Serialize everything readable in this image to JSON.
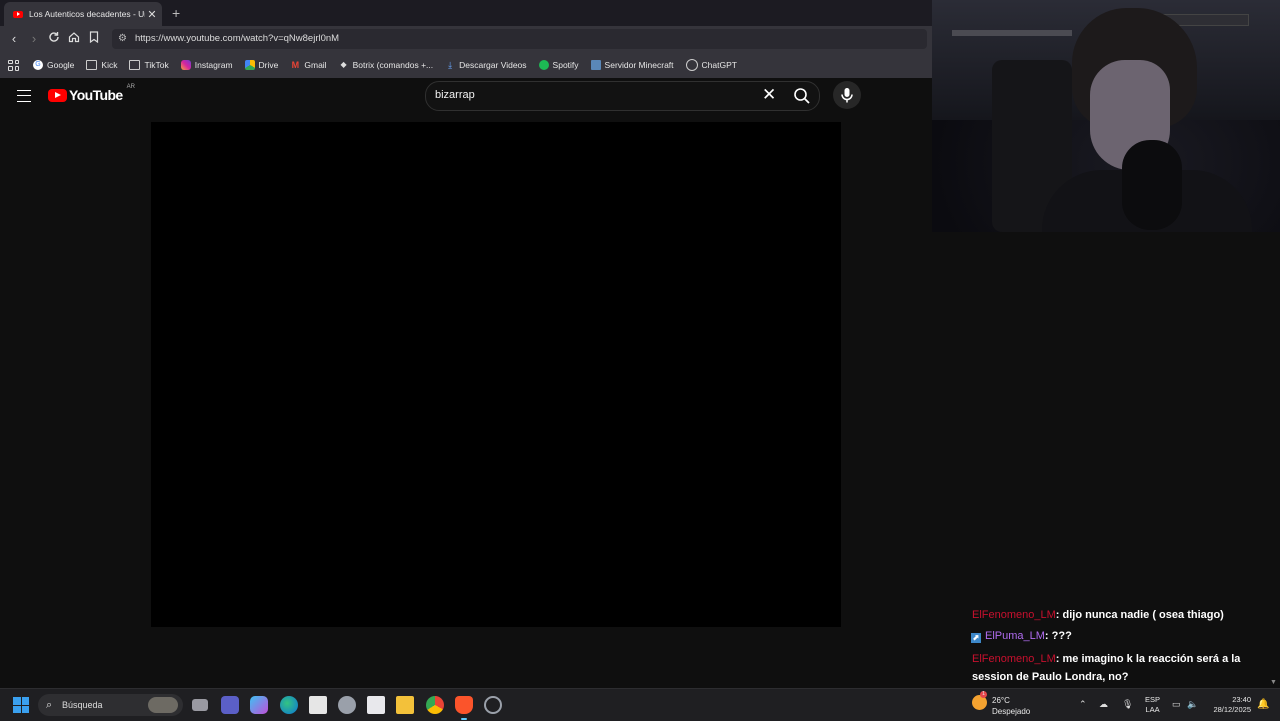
{
  "browser": {
    "tab_title": "Los Autenticos decadentes - Un",
    "tab_close": "✕",
    "new_tab": "+",
    "url": "https://www.youtube.com/watch?v=qNw8ejrl0nM",
    "bookmarks": [
      "Google",
      "Kick",
      "TikTok",
      "Instagram",
      "Drive",
      "Gmail",
      "Botrix (comandos +...",
      "Descargar Videos",
      "Spotify",
      "Servidor Minecraft",
      "ChatGPT"
    ]
  },
  "youtube": {
    "logo_text": "YouTube",
    "country_code": "AR",
    "search_value": "bizarrap",
    "clear_glyph": "✕"
  },
  "chat": {
    "messages": [
      {
        "user": "ElFenomeno_LM",
        "text": ": dijo nunca nadie ( osea thiago)"
      },
      {
        "user": "ElPuma_LM",
        "text": ": ???"
      },
      {
        "user": "ElFenomeno_LM",
        "text": ": me imagino k la reacción será a la session de Paulo Londra, no?"
      }
    ]
  },
  "taskbar": {
    "search_label": "Búsqueda",
    "weather_badge": "1",
    "temperature": "26°C",
    "condition": "Despejado",
    "lang_top": "ESP",
    "lang_bottom": "LAA",
    "time": "23:40",
    "date": "28/12/2025"
  },
  "colors": {
    "youtube_red": "#ff0000",
    "chat_user_red": "#c8102e",
    "chat_user_purple": "#b06cf0"
  }
}
